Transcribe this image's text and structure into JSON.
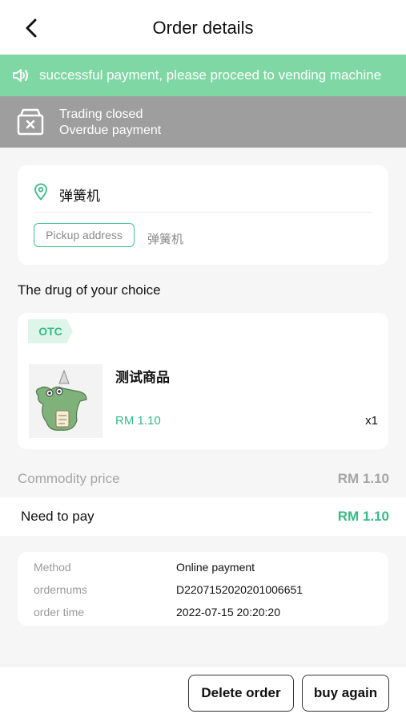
{
  "header": {
    "title": "Order details",
    "back_icon": "chevron-left-icon"
  },
  "notice": {
    "text": "successful payment, please proceed to vending machine",
    "icon": "speaker-icon",
    "bg_color": "#7fd7a4"
  },
  "status": {
    "line1": "Trading closed",
    "line2": "Overdue payment",
    "icon": "closed-box-icon"
  },
  "location": {
    "machine_name": "弹簧机",
    "pickup_label": "Pickup address",
    "pickup_value": "弹簧机"
  },
  "section_title": "The drug of your choice",
  "product": {
    "tag": "OTC",
    "name": "测试商品",
    "price": "RM 1.10",
    "qty": "x1",
    "image": "crocodile-with-party-hat-image"
  },
  "summary": {
    "commodity_label": "Commodity price",
    "commodity_value": "RM 1.10",
    "pay_label": "Need to pay",
    "pay_value": "RM 1.10"
  },
  "info": [
    {
      "label": "Method",
      "value": "Online payment"
    },
    {
      "label": "ordernums",
      "value": "D2207152020201006651"
    },
    {
      "label": "order time",
      "value": "2022-07-15 20:20:20"
    }
  ],
  "actions": {
    "delete": "Delete order",
    "buy_again": "buy again"
  },
  "colors": {
    "accent": "#3ab987",
    "status_bg": "#9e9e9e"
  }
}
